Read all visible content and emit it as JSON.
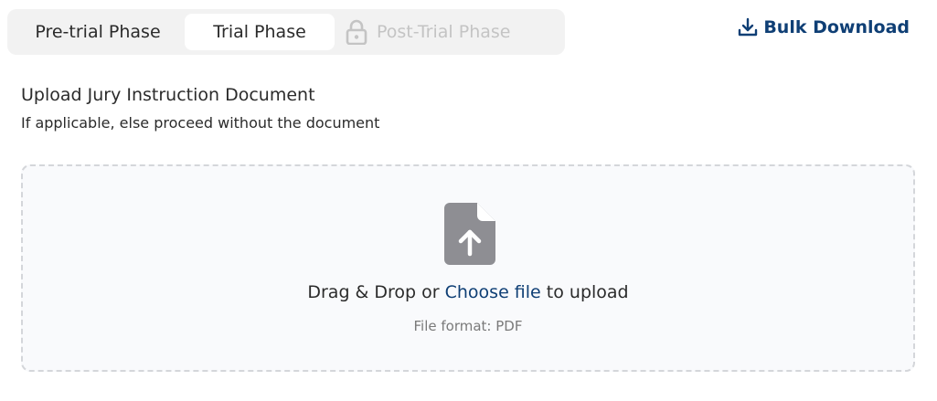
{
  "tabs": [
    {
      "label": "Pre-trial Phase",
      "state": "inactive"
    },
    {
      "label": "Trial Phase",
      "state": "active"
    },
    {
      "label": "Post-Trial Phase",
      "state": "locked"
    }
  ],
  "bulk_download": {
    "label": "Bulk Download",
    "icon": "download-icon"
  },
  "upload": {
    "title": "Upload Jury Instruction Document",
    "subtitle": "If applicable, else proceed without the document",
    "drag_text_prefix": "Drag & Drop or ",
    "choose_link": "Choose file",
    "drag_text_suffix": " to upload",
    "format_text": "File format: PDF",
    "icon": "file-upload-icon"
  },
  "colors": {
    "accent": "#0f3f75",
    "tab_bg": "#f2f2f2",
    "locked_text": "#c4c4c4",
    "dropzone_bg": "#f9fafc",
    "icon_gray": "#8e8e93"
  }
}
